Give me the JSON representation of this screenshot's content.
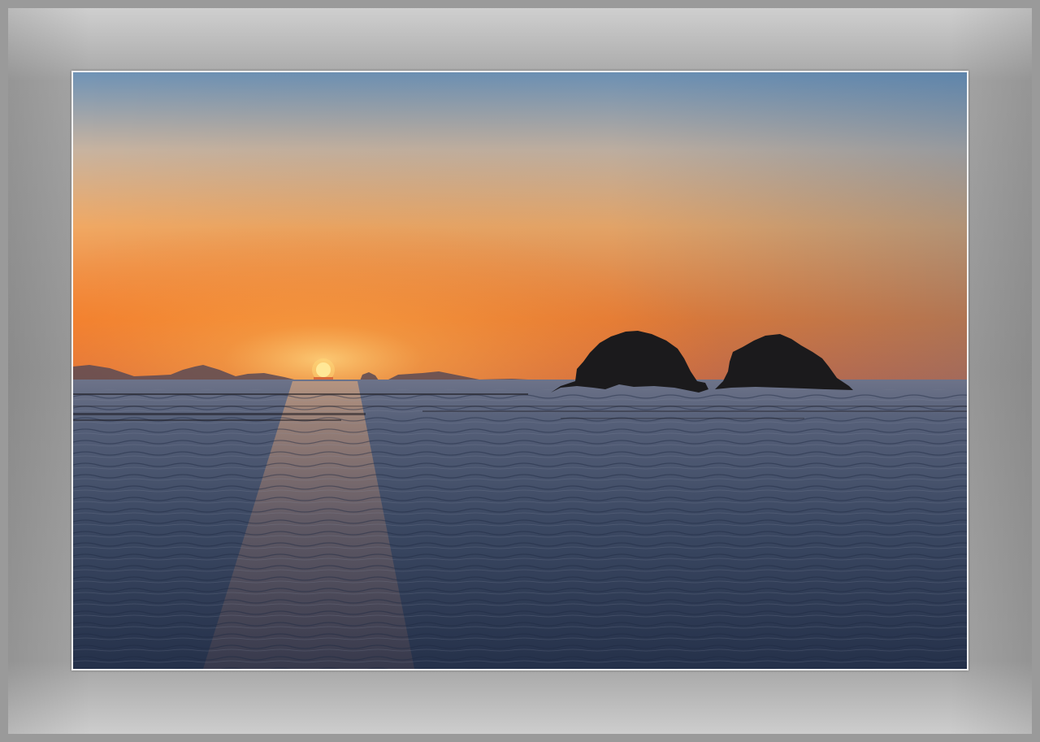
{
  "scene": {
    "description_icon": "sunset-seascape",
    "elements": [
      "sky",
      "sun",
      "distant-mountains",
      "left-island",
      "right-island",
      "sea",
      "buoy-lines"
    ]
  },
  "colors": {
    "frame_mat": "#9a9a9a",
    "frame_border": "#f2f2f2",
    "sky_top": "#6f93b6",
    "sky_mid": "#e9a86a",
    "sky_horizon": "#ec6a1f",
    "sun": "#fff2a8",
    "island": "#1b1a1c",
    "sea_near": "#283650",
    "sea_far": "#6e7890"
  }
}
